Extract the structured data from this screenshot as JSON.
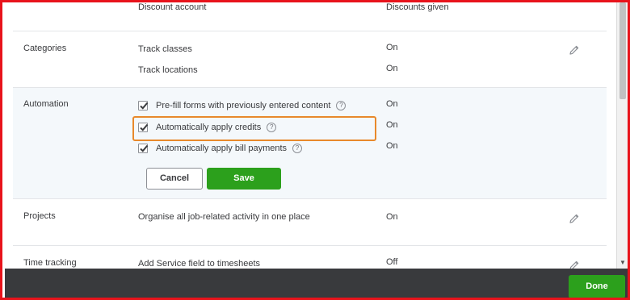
{
  "top_row": {
    "label": "Discount account",
    "value": "Discounts given"
  },
  "categories": {
    "label": "Categories",
    "rows": [
      {
        "text": "Track classes",
        "value": "On"
      },
      {
        "text": "Track locations",
        "value": "On"
      }
    ]
  },
  "automation": {
    "label": "Automation",
    "rows": [
      {
        "text": "Pre-fill forms with previously entered content",
        "value": "On",
        "checked": true
      },
      {
        "text": "Automatically apply credits",
        "value": "On",
        "checked": true
      },
      {
        "text": "Automatically apply bill payments",
        "value": "On",
        "checked": true
      }
    ],
    "help_glyph": "?",
    "cancel_label": "Cancel",
    "save_label": "Save"
  },
  "projects": {
    "label": "Projects",
    "text": "Organise all job-related activity in one place",
    "value": "On"
  },
  "time_tracking": {
    "label": "Time tracking",
    "text": "Add Service field to timesheets",
    "value": "Off"
  },
  "footer": {
    "done_label": "Done"
  },
  "colors": {
    "frame_border": "#e8131b",
    "highlight": "#e8892b",
    "primary_green": "#2ca01c",
    "footer_bg": "#393a3d",
    "automation_bg": "#f4f8fb"
  },
  "icons": {
    "edit": "pencil-icon",
    "help": "help-circle-icon",
    "check": "checkmark-icon",
    "scroll_down": "chevron-down-icon"
  }
}
